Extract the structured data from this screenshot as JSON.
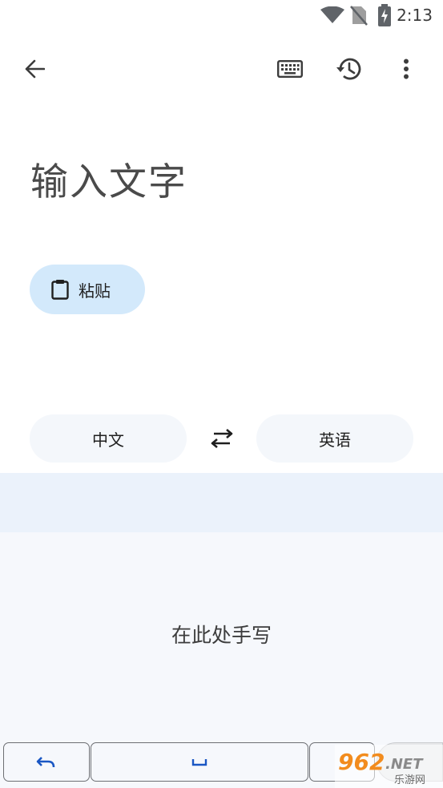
{
  "status_bar": {
    "time": "2:13",
    "icons": [
      "wifi-icon",
      "no-sim-icon",
      "battery-charging-icon"
    ]
  },
  "toolbar": {
    "back_icon": "arrow-back-icon",
    "keyboard_icon": "keyboard-icon",
    "history_icon": "history-icon",
    "more_icon": "more-vert-icon"
  },
  "input": {
    "placeholder": "输入文字"
  },
  "paste": {
    "label": "粘贴",
    "icon": "clipboard-icon"
  },
  "languages": {
    "source": "中文",
    "target": "英语",
    "swap_icon": "swap-horiz-icon"
  },
  "handwriting": {
    "hint": "在此处手写"
  },
  "keys": {
    "undo_icon": "undo-icon",
    "space_icon": "space-icon"
  },
  "watermark": {
    "brand": "962.NET",
    "sub": "乐游网"
  },
  "colors": {
    "chip_bg": "#d3e9fb",
    "pill_bg": "#f4f7fb",
    "hw_header_bg": "#ebf2fb",
    "hw_area_bg": "#f6f8fc",
    "key_icon": "#1a57c4",
    "watermark_orange": "#f28c1e"
  }
}
